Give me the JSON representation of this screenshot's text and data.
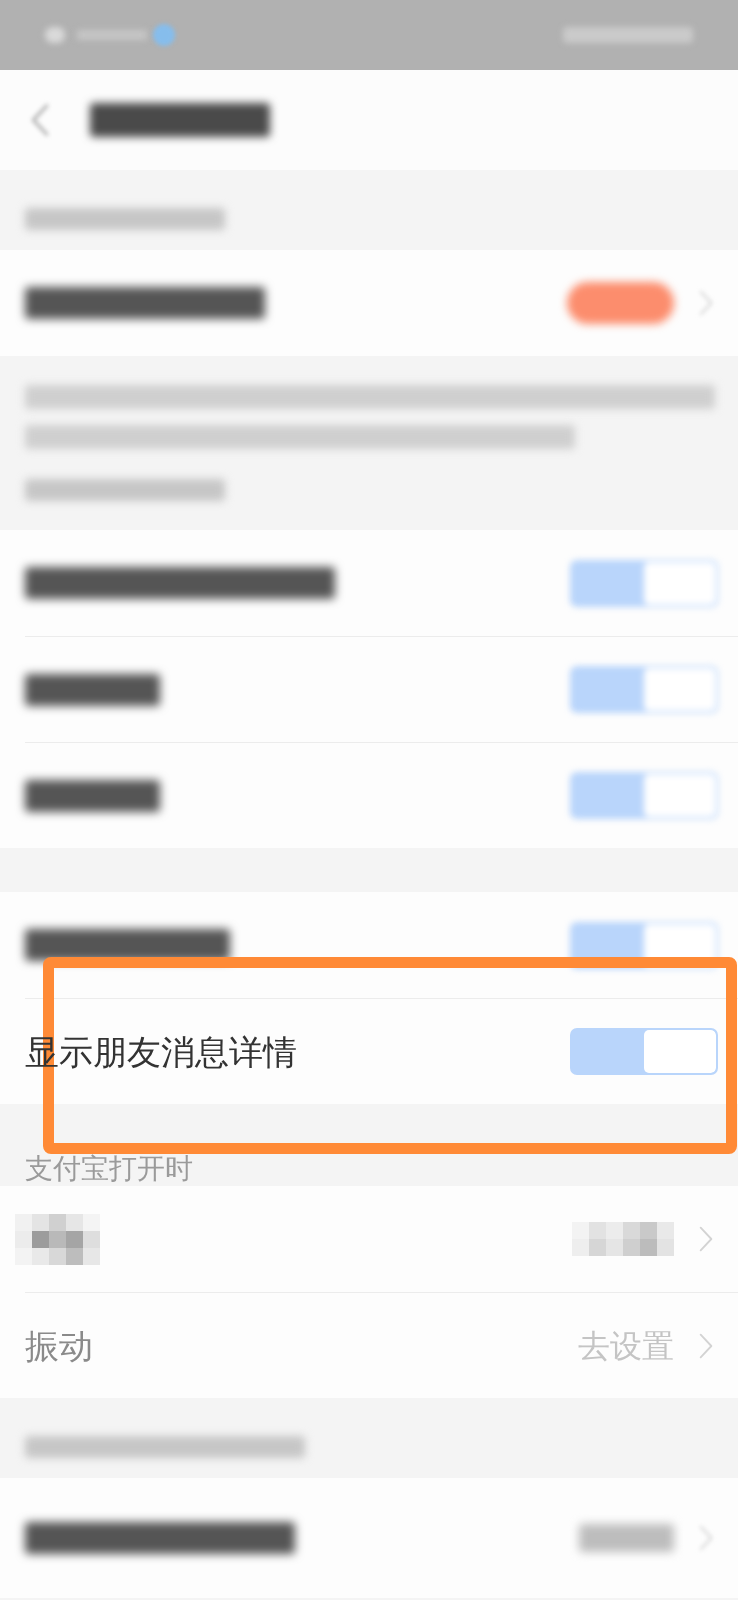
{
  "status_bar": {
    "kind": "blurred"
  },
  "nav_bar": {
    "kind": "blurred"
  },
  "groups": [
    {
      "caption": {
        "kind": "blurred"
      },
      "rows": [
        {
          "kind": "badge",
          "blurred": true
        }
      ]
    },
    {
      "note": {
        "kind": "blurred"
      },
      "caption": {
        "kind": "blurred"
      },
      "rows": [
        {
          "kind": "toggle",
          "blurred": true,
          "on": true
        },
        {
          "kind": "toggle",
          "blurred": true,
          "on": true
        },
        {
          "kind": "toggle",
          "blurred": true,
          "on": true
        }
      ]
    },
    {
      "rows": [
        {
          "kind": "toggle",
          "blurred": true,
          "on": true
        },
        {
          "kind": "toggle",
          "blurred": false,
          "label": "显示朋友消息详情",
          "on": true,
          "highlighted": true
        }
      ]
    },
    {
      "caption": {
        "kind": "text",
        "text": "支付宝打开时"
      },
      "rows": [
        {
          "kind": "link",
          "blurred": false,
          "pixelated": true
        },
        {
          "kind": "link",
          "blurred": false,
          "label": "振动",
          "value": "去设置"
        }
      ]
    },
    {
      "caption": {
        "kind": "blurred"
      },
      "rows": [
        {
          "kind": "link",
          "blurred": true
        }
      ]
    }
  ]
}
